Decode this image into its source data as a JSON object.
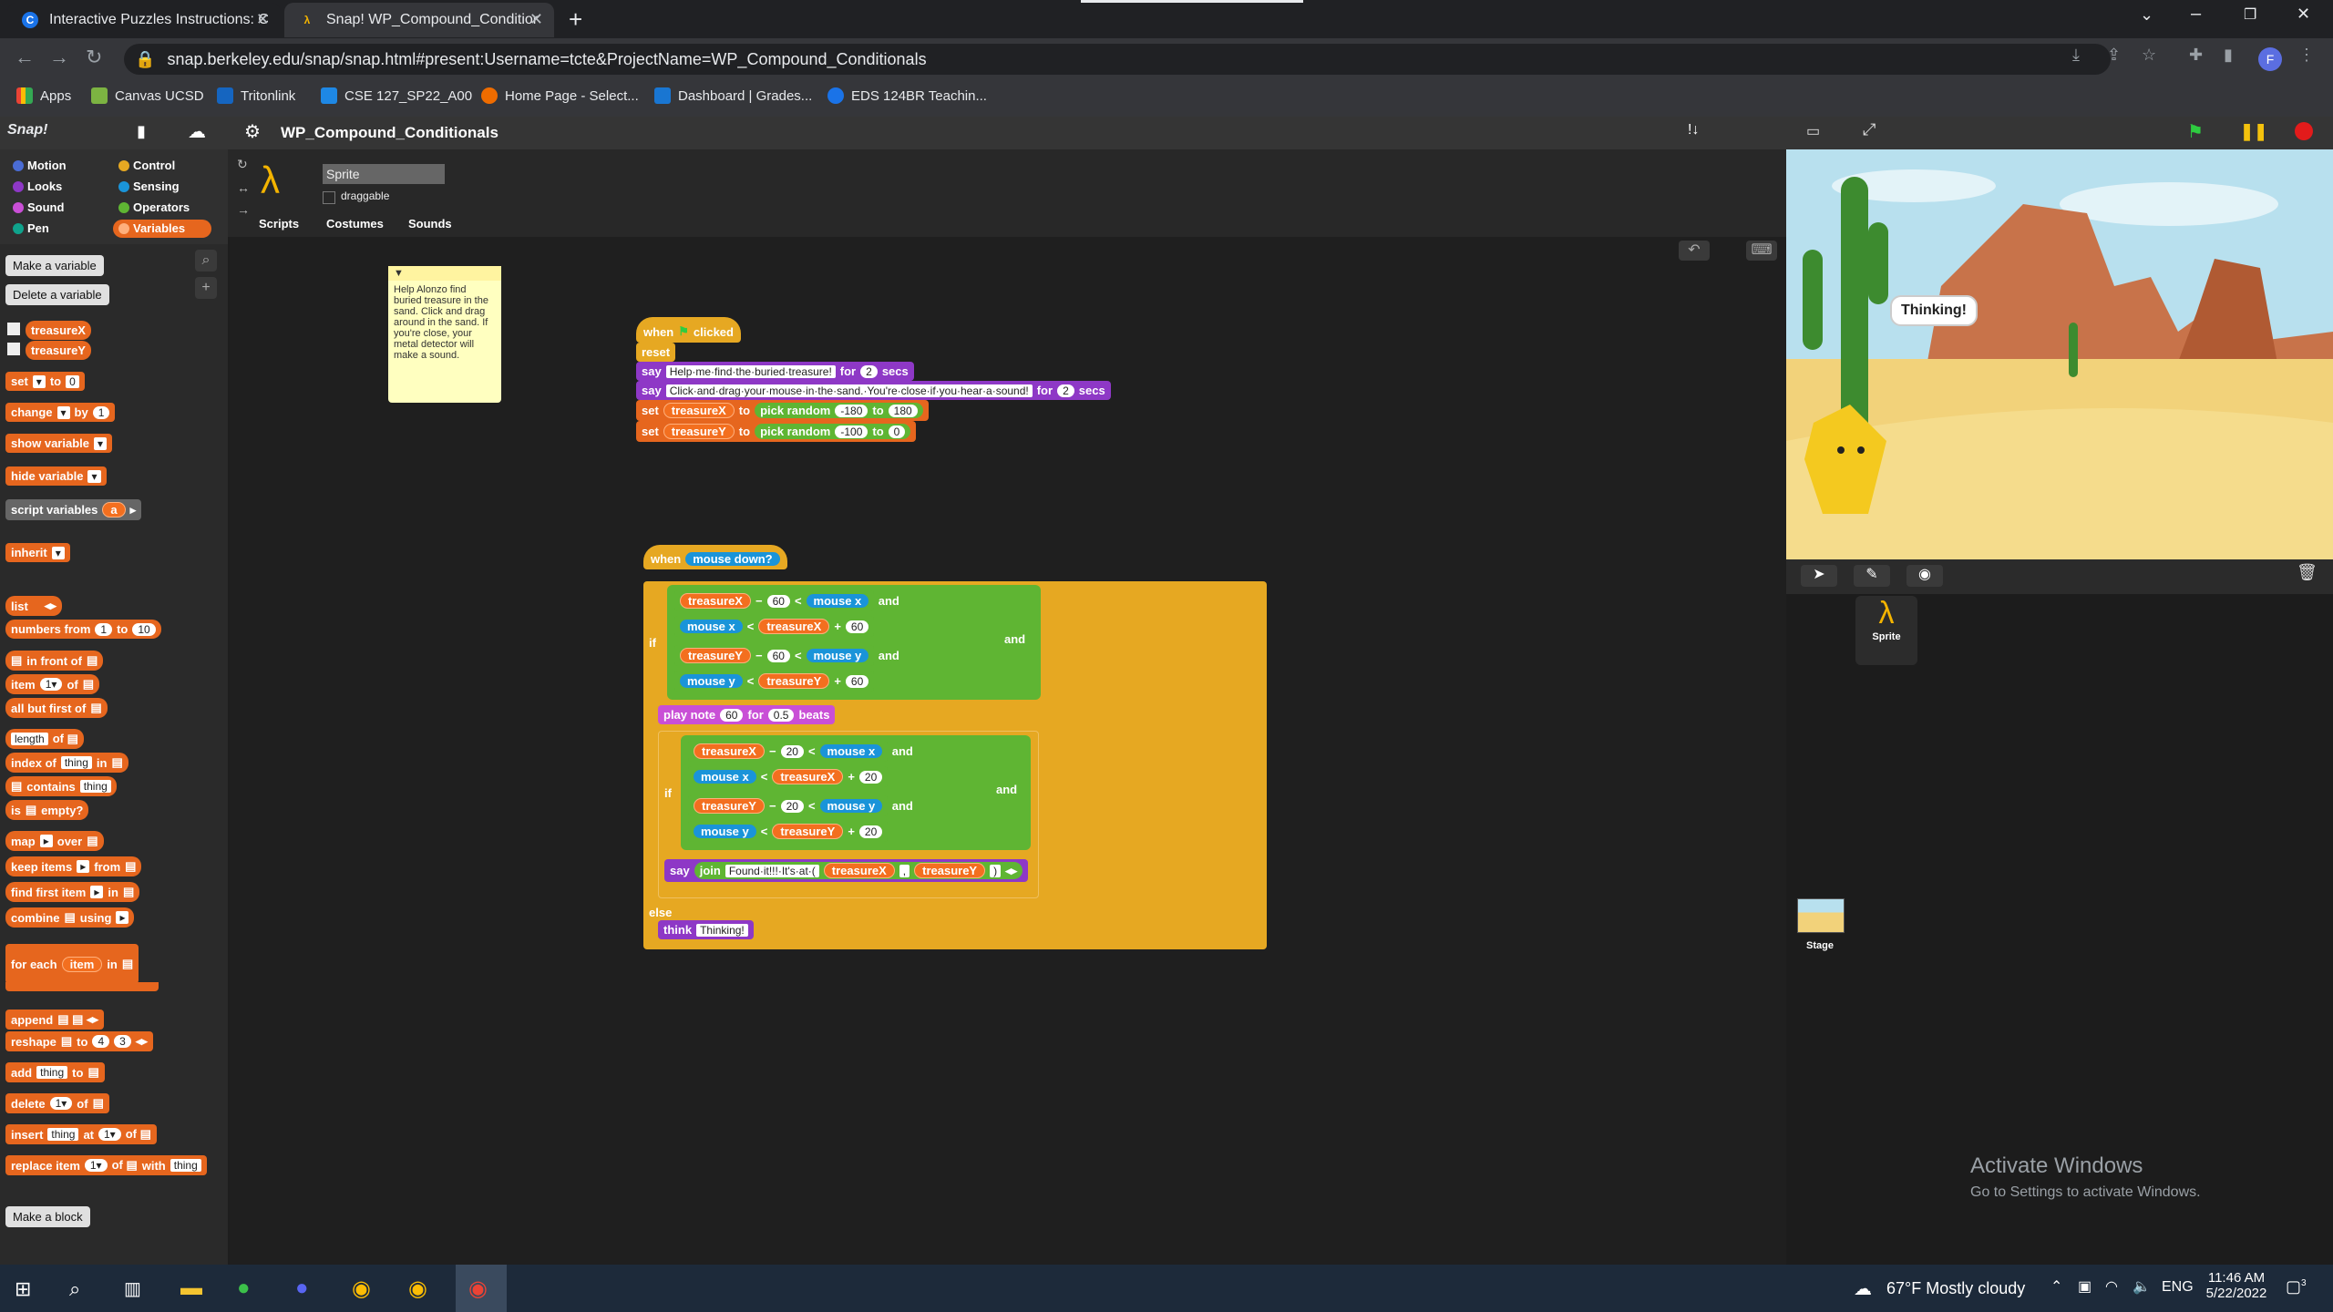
{
  "browser": {
    "tabs": [
      {
        "title": "Interactive Puzzles Instructions: C",
        "favicon": "C"
      },
      {
        "title": "Snap! WP_Compound_Condition",
        "favicon": "λ"
      }
    ],
    "url": "snap.berkeley.edu/snap/snap.html#present:Username=tcte&ProjectName=WP_Compound_Conditionals",
    "bookmarks": [
      "Apps",
      "Canvas UCSD",
      "Tritonlink",
      "CSE 127_SP22_A00",
      "Home Page - Select...",
      "Dashboard | Grades...",
      "EDS 124BR Teachin..."
    ],
    "profile_initial": "F"
  },
  "snap": {
    "logo": "Snap!",
    "project_name": "WP_Compound_Conditionals",
    "categories": [
      "Motion",
      "Looks",
      "Sound",
      "Pen",
      "Control",
      "Sensing",
      "Operators",
      "Variables"
    ],
    "sprite_name": "Sprite",
    "draggable_label": "draggable",
    "tabs": [
      "Scripts",
      "Costumes",
      "Sounds"
    ],
    "palette": {
      "make_var": "Make a variable",
      "delete_var": "Delete a variable",
      "vars": [
        "treasureX",
        "treasureY"
      ],
      "blocks": [
        "set",
        "to",
        "0",
        "change",
        "by",
        "1",
        "show variable",
        "hide variable",
        "script variables",
        "a",
        "inherit",
        "list",
        "numbers from",
        "1",
        "10",
        "in front of",
        "item",
        "of",
        "all but first of",
        "length",
        "index of",
        "thing",
        "in",
        "contains",
        "is",
        "empty?",
        "map",
        "over",
        "keep items",
        "from",
        "find first item",
        "in",
        "combine",
        "using",
        "for each",
        "item",
        "in",
        "append",
        "reshape",
        "to",
        "4",
        "3",
        "add",
        "thing",
        "to",
        "delete",
        "1",
        "of",
        "insert",
        "at",
        "replace item",
        "with"
      ],
      "make_block": "Make a block"
    },
    "comment": "Help Alonzo find buried treasure in the sand. Click and drag around in the sand. If you're close, your metal detector will make a sound.",
    "script1": {
      "hat": [
        "when",
        "clicked"
      ],
      "reset": "reset",
      "say1": {
        "label": "say",
        "text": "Help·me·find·the·buried·treasure!",
        "for": "for",
        "secs_val": "2",
        "secs": "secs"
      },
      "say2": {
        "label": "say",
        "text": "Click·and·drag·your·mouse·in·the·sand.·You're·close·if·you·hear·a·sound!",
        "for": "for",
        "secs_val": "2",
        "secs": "secs"
      },
      "set1": {
        "label": "set",
        "var": "treasureX",
        "to": "to",
        "pick": "pick random",
        "from": "-180",
        "to2": "to",
        "to_val": "180"
      },
      "set2": {
        "label": "set",
        "var": "treasureY",
        "to": "to",
        "pick": "pick random",
        "from": "-100",
        "to2": "to",
        "to_val": "0"
      }
    },
    "script2": {
      "hat": [
        "when",
        "mouse down?"
      ],
      "if": "if",
      "and": "and",
      "outer_cond": [
        [
          "treasureX",
          "−",
          "60",
          "<",
          "mouse x"
        ],
        [
          "mouse x",
          "<",
          "treasureX",
          "+",
          "60"
        ],
        [
          "treasureY",
          "−",
          "60",
          "<",
          "mouse y"
        ],
        [
          "mouse y",
          "<",
          "treasureY",
          "+",
          "60"
        ]
      ],
      "play_note": {
        "label": "play note",
        "note": "60",
        "for": "for",
        "beats_val": "0.5",
        "beats": "beats"
      },
      "inner_cond": [
        [
          "treasureX",
          "−",
          "20",
          "<",
          "mouse x"
        ],
        [
          "mouse x",
          "<",
          "treasureX",
          "+",
          "20"
        ],
        [
          "treasureY",
          "−",
          "20",
          "<",
          "mouse y"
        ],
        [
          "mouse y",
          "<",
          "treasureY",
          "+",
          "20"
        ]
      ],
      "say_join": {
        "say": "say",
        "join": "join",
        "text1": "Found·it!!!·It's·at·(",
        "v1": "treasureX",
        "sep": ",",
        "v2": "treasureY",
        "close": ")"
      },
      "else": "else",
      "think": {
        "label": "think",
        "text": "Thinking!"
      }
    },
    "stage_bubble": "Thinking!",
    "corral": {
      "sprite": "Sprite",
      "stage": "Stage"
    }
  },
  "windows": {
    "activate_title": "Activate Windows",
    "activate_sub": "Go to Settings to activate Windows.",
    "weather": "67°F  Mostly cloudy",
    "lang": "ENG",
    "time": "11:46 AM",
    "date": "5/22/2022",
    "notif_count": "3"
  },
  "colors": {
    "variables": "#e6661e",
    "looks": "#8e38c6",
    "control": "#e6a822",
    "operators": "#5fb533",
    "sensing": "#1a94d9",
    "sound": "#c94fd6"
  }
}
